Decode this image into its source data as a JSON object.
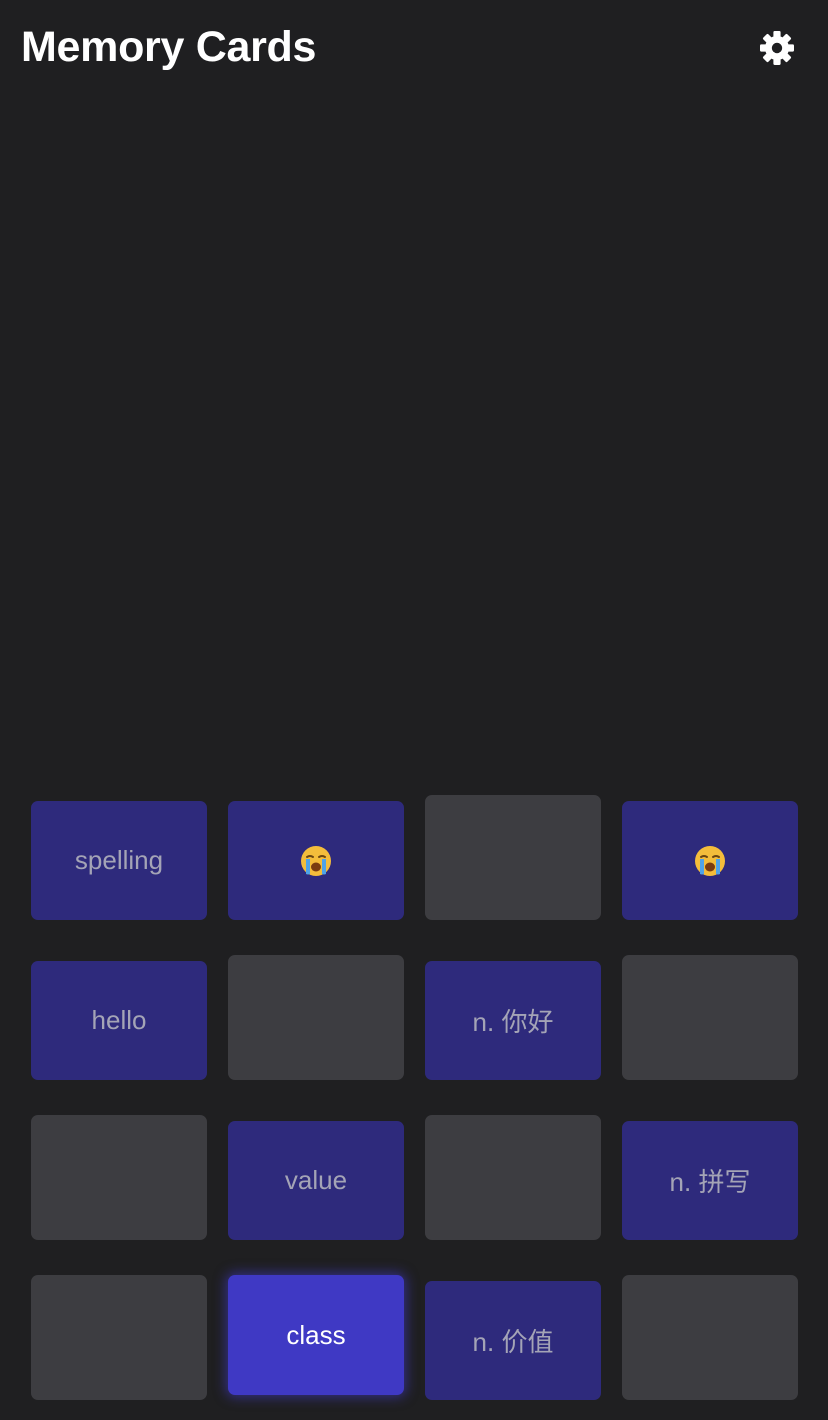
{
  "header": {
    "title": "Memory Cards",
    "settings_icon": "gear-icon"
  },
  "colors": {
    "background": "#1f1f21",
    "card_face_up": "#2e2a7c",
    "card_face_down": "#3d3d41",
    "card_selected": "#3f39c4",
    "card_text": "#a4a4b6"
  },
  "cards": [
    {
      "state": "face-up",
      "label": "spelling"
    },
    {
      "state": "face-up",
      "label": "",
      "icon": "loudly-crying-face-emoji"
    },
    {
      "state": "face-down",
      "label": ""
    },
    {
      "state": "face-up",
      "label": "",
      "icon": "loudly-crying-face-emoji"
    },
    {
      "state": "face-up",
      "label": "hello"
    },
    {
      "state": "face-down",
      "label": ""
    },
    {
      "state": "face-up",
      "label": "n. 你好"
    },
    {
      "state": "face-down",
      "label": ""
    },
    {
      "state": "face-down",
      "label": ""
    },
    {
      "state": "face-up",
      "label": "value"
    },
    {
      "state": "face-down",
      "label": ""
    },
    {
      "state": "face-up",
      "label": "n. 拼写"
    },
    {
      "state": "face-down",
      "label": ""
    },
    {
      "state": "selected",
      "label": "class"
    },
    {
      "state": "face-up",
      "label": "n. 价值"
    },
    {
      "state": "face-down",
      "label": ""
    }
  ]
}
